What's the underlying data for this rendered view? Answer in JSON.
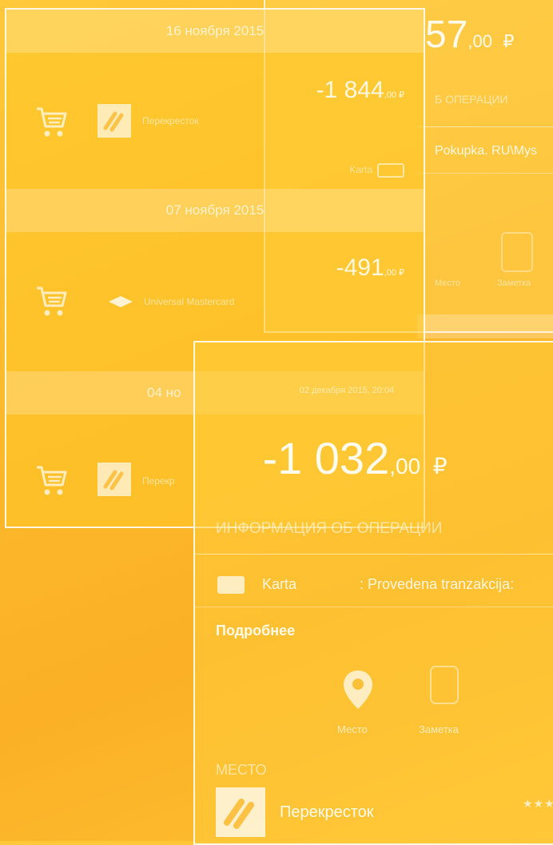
{
  "back_detail": {
    "amount_main": "57",
    "amount_kop": ",00",
    "currency": "₽",
    "section_heading": "Б ОПЕРАЦИИ",
    "description": "Pokupka. RU\\Mys",
    "place_label": "Место",
    "note_label": "Заметка"
  },
  "operations": [
    {
      "date": "16 ноября 2015",
      "amount": "-1 844",
      "kop": ",00 ₽",
      "merchant": "Перекресток",
      "card_text": "Karta",
      "icon": "cart-icon",
      "logo": "perekrestok-logo"
    },
    {
      "date": "07 ноября 2015",
      "amount": "-491",
      "kop": ",00 ₽",
      "merchant": "Universal Mastercard",
      "icon": "cart-icon",
      "logo": "mastercard-logo"
    },
    {
      "date": "04 но",
      "merchant": "Перекр",
      "icon": "cart-icon",
      "logo": "perekrestok-logo"
    }
  ],
  "detail": {
    "datetime": "02 декабря 2015, 20:04",
    "amount_main": "-1 032",
    "amount_kop": ",00",
    "currency": "₽",
    "info_heading": "ИНФОРМАЦИЯ ОБ ОПЕРАЦИИ",
    "card_label": "Karta",
    "card_text": ": Provedena tranzakcija:",
    "more_link": "Подробнее",
    "place_button": "Место",
    "note_button": "Заметка",
    "place_section": "МЕСТО",
    "place_name": "Перекресток",
    "rating": "★★★"
  },
  "colors": {
    "background": "#fdb92c",
    "accent": "#ffffff"
  }
}
